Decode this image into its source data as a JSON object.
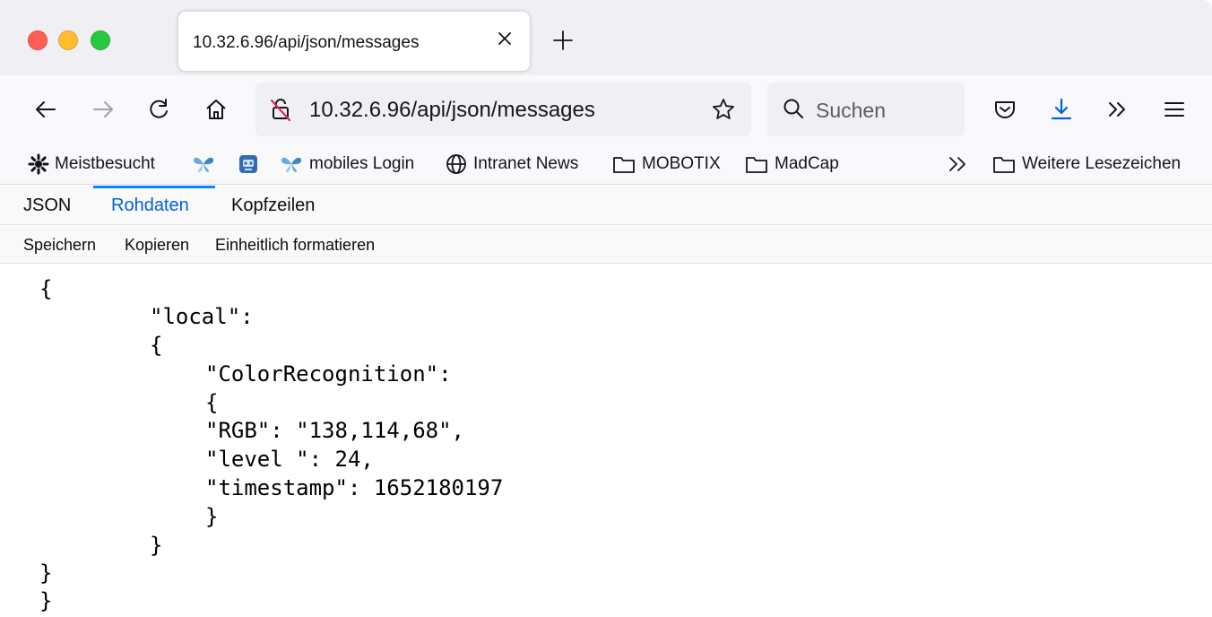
{
  "window": {
    "tab_title": "10.32.6.96/api/json/messages"
  },
  "navbar": {
    "url": "10.32.6.96/api/json/messages",
    "search_placeholder": "Suchen"
  },
  "bookmarks": {
    "items": [
      {
        "label": "Meistbesucht",
        "icon": "gear-icon"
      },
      {
        "label": "",
        "icon": "butterfly-icon"
      },
      {
        "label": "",
        "icon": "robot-icon"
      },
      {
        "label": "mobiles Login",
        "icon": "butterfly-icon"
      },
      {
        "label": "Intranet News",
        "icon": "globe-icon"
      },
      {
        "label": "MOBOTIX",
        "icon": "folder-icon"
      },
      {
        "label": "MadCap",
        "icon": "folder-icon"
      },
      {
        "label": "Weitere Lesezeichen",
        "icon": "folder-icon"
      }
    ]
  },
  "viewer": {
    "tabs": [
      "JSON",
      "Rohdaten",
      "Kopfzeilen"
    ],
    "active_tab": "Rohdaten",
    "tools": [
      "Speichern",
      "Kopieren",
      "Einheitlich formatieren"
    ]
  },
  "raw": {
    "lines": [
      "{",
      "\"local\":",
      "{",
      "\"ColorRecognition\":",
      "{",
      "\"RGB\": \"138,114,68\",",
      "\"level \": 24,",
      "\"timestamp\": 1652180197",
      "}",
      "}",
      "}",
      "}"
    ]
  },
  "colors": {
    "accent": "#0060df",
    "download_icon": "#0060df",
    "tab_strip": "#f0f0f4",
    "toolbar": "#f9f9fb"
  }
}
